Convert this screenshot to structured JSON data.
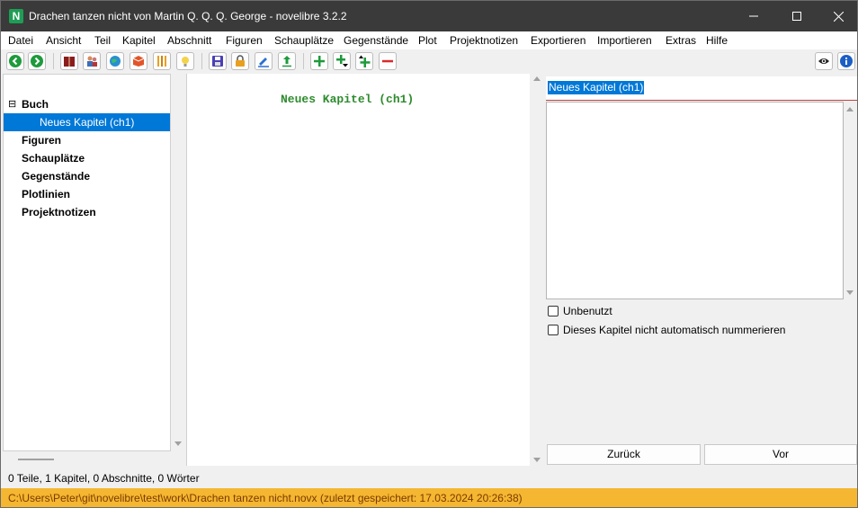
{
  "window": {
    "title": "Drachen tanzen nicht von Martin Q. Q. Q.  George - novelibre 3.2.2",
    "app_icon_letter": "N"
  },
  "menu": [
    "Datei",
    "Ansicht",
    "Teil",
    "Kapitel",
    "Abschnitt",
    "Figuren",
    "Schauplätze",
    "Gegenstände",
    "Plot",
    "Projektnotizen",
    "Exportieren",
    "Importieren",
    "Extras",
    "Hilfe"
  ],
  "toolbar": {
    "icons": [
      "back-icon",
      "forward-icon",
      "book-icon",
      "characters-icon",
      "locations-icon",
      "items-icon",
      "plotlines-icon",
      "project-notes-icon",
      "save-icon",
      "lock-icon",
      "edit-icon",
      "export-icon",
      "add-icon",
      "add-child-icon",
      "add-parent-icon",
      "delete-icon",
      "view-icon",
      "info-icon"
    ]
  },
  "tree": {
    "items": [
      {
        "label": "Buch",
        "bold": true,
        "expander": "⊟"
      },
      {
        "label": "Neues Kapitel (ch1)",
        "bold": false,
        "selected": true
      },
      {
        "label": "Figuren",
        "bold": true
      },
      {
        "label": "Schauplätze",
        "bold": true
      },
      {
        "label": "Gegenstände",
        "bold": true
      },
      {
        "label": "Plotlinien",
        "bold": true
      },
      {
        "label": "Projektnotizen",
        "bold": true
      }
    ]
  },
  "editor": {
    "heading": "Neues Kapitel (ch1)"
  },
  "properties": {
    "title_value": "Neues Kapitel (ch1)",
    "notes_value": "",
    "checkbox_unused": {
      "label": "Unbenutzt",
      "checked": false
    },
    "checkbox_no_number": {
      "label": "Dieses Kapitel nicht automatisch nummerieren",
      "checked": false
    },
    "back_button": "Zurück",
    "next_button": "Vor"
  },
  "status": {
    "counts": "0 Teile, 1 Kapitel, 0 Abschnitte, 0 Wörter",
    "path": "C:\\Users\\Peter\\git\\novelibre\\test\\work\\Drachen tanzen nicht.novx (zuletzt gespeichert: 17.03.2024 20:26:38)"
  },
  "colors": {
    "titlebar": "#3a3a3a",
    "selection": "#0078d7",
    "heading_green": "#2e8b2e",
    "pathbar": "#f5b631"
  }
}
